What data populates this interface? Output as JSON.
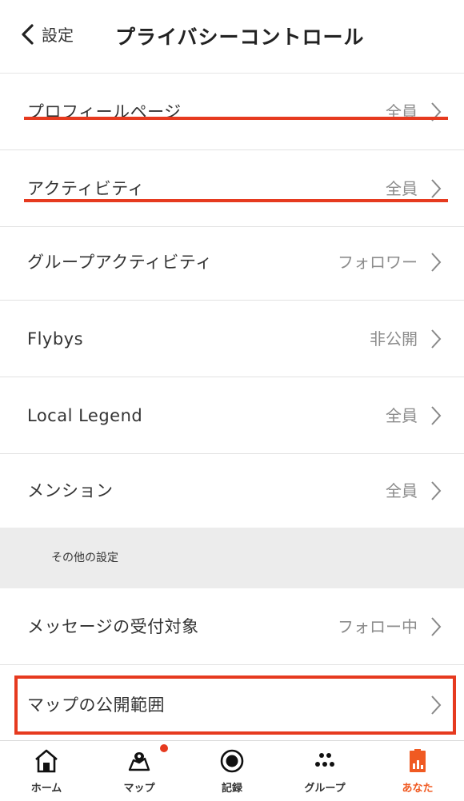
{
  "header": {
    "back_label": "設定",
    "title": "プライバシーコントロール"
  },
  "rows": [
    {
      "label": "プロフィールページ",
      "value": "全員"
    },
    {
      "label": "アクティビティ",
      "value": "全員"
    },
    {
      "label": "グループアクティビティ",
      "value": "フォロワー"
    },
    {
      "label": "Flybys",
      "value": "非公開"
    },
    {
      "label": "Local Legend",
      "value": "全員"
    },
    {
      "label": "メンション",
      "value": "全員"
    }
  ],
  "section": {
    "title": "その他の設定"
  },
  "other_rows": [
    {
      "label": "メッセージの受付対象",
      "value": "フォロー中"
    },
    {
      "label": "マップの公開範囲",
      "value": ""
    }
  ],
  "tabbar": {
    "tabs": [
      {
        "label": "ホーム",
        "icon": "home-icon"
      },
      {
        "label": "マップ",
        "icon": "map-icon"
      },
      {
        "label": "記録",
        "icon": "record-icon"
      },
      {
        "label": "グループ",
        "icon": "groups-icon"
      },
      {
        "label": "あなた",
        "icon": "you-icon"
      }
    ]
  },
  "colors": {
    "accent": "#f05a22",
    "highlight": "#e63a1f",
    "section_bg": "#ececec"
  }
}
